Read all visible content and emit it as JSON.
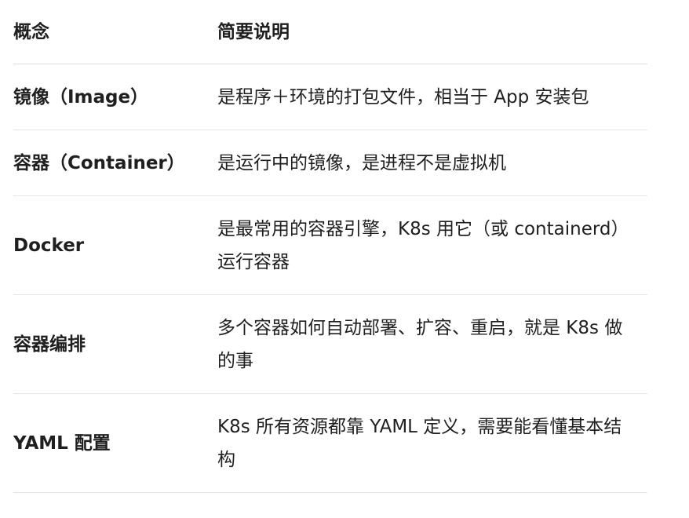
{
  "table": {
    "headers": [
      "概念",
      "简要说明"
    ],
    "rows": [
      {
        "concept": "镜像（Image）",
        "description": "是程序＋环境的打包文件，相当于 App 安装包"
      },
      {
        "concept": "容器（Container）",
        "description": "是运行中的镜像，是进程不是虚拟机"
      },
      {
        "concept": "Docker",
        "description": "是最常用的容器引擎，K8s 用它（或 containerd）运行容器"
      },
      {
        "concept": "容器编排",
        "description": "多个容器如何自动部署、扩容、重启，就是 K8s 做的事"
      },
      {
        "concept": "YAML 配置",
        "description": "K8s 所有资源都靠 YAML 定义，需要能看懂基本结构"
      }
    ]
  }
}
